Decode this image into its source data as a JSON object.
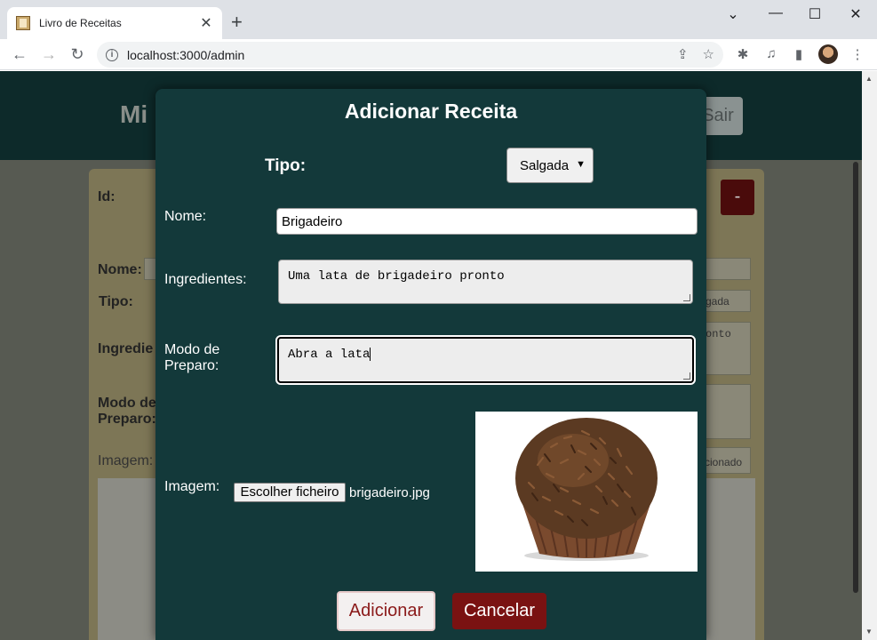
{
  "browser": {
    "tab_title": "Livro de Receitas",
    "url": "localhost:3000/admin"
  },
  "page": {
    "brand": "Mi",
    "sair_label": "Sair",
    "minus_label": "-",
    "id_label": "Id:",
    "nome_label": "Nome:",
    "tipo_label": "Tipo:",
    "ingredientes_label": "Ingredie",
    "modo_label_1": "Modo de",
    "modo_label_2": "Preparo:",
    "imagem_label": "Imagem:",
    "bg_select_value": "gada",
    "bg_ingredients_text": "onto",
    "bg_file_text": "cionado"
  },
  "modal": {
    "title": "Adicionar Receita",
    "tipo_label": "Tipo:",
    "tipo_value": "Salgada",
    "nome_label": "Nome:",
    "nome_value": "Brigadeiro",
    "ingredientes_label": "Ingredientes:",
    "ingredientes_value": "Uma lata de brigadeiro pronto",
    "modo_label_1": "Modo de",
    "modo_label_2": "Preparo:",
    "modo_value": "Abra a lata",
    "imagem_label": "Imagem:",
    "file_button_label": "Escolher ficheiro",
    "file_name": "brigadeiro.jpg",
    "add_label": "Adicionar",
    "cancel_label": "Cancelar"
  },
  "colors": {
    "modal_bg": "#13393a",
    "header_bg": "#0d2a2a",
    "cancel_bg": "#7a1212",
    "add_text": "#8b1a1a"
  }
}
